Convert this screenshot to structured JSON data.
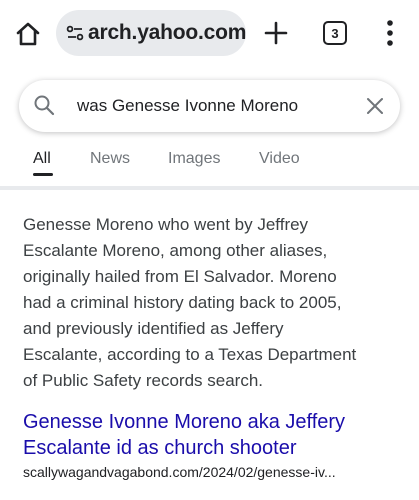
{
  "browser": {
    "url_text": "arch.yahoo.com",
    "tab_count": "3",
    "icons": {
      "home": "home-icon",
      "site_info": "tune-icon",
      "new_tab": "plus-icon",
      "menu": "more-vert-icon"
    }
  },
  "search": {
    "query": "was Genesse Ivonne Moreno",
    "icons": {
      "search": "search-icon",
      "clear": "close-icon"
    }
  },
  "tabs": [
    {
      "label": "All",
      "active": true
    },
    {
      "label": "News",
      "active": false
    },
    {
      "label": "Images",
      "active": false
    },
    {
      "label": "Video",
      "active": false
    }
  ],
  "result": {
    "snippet_lines": [
      "Genesse Moreno who went by Jeffrey",
      "Escalante Moreno, among other aliases,",
      "originally hailed from El Salvador. Moreno",
      "had a criminal history dating back to 2005,",
      "and previously identified as Jeffery",
      "Escalante, according to a Texas Department",
      "of Public Safety records search."
    ],
    "title_lines": [
      "Genesse Ivonne Moreno aka Jeffery",
      "Escalante id as church shooter"
    ],
    "display_url": "scallywagandvagabond.com/2024/02/genesse-iv..."
  },
  "colors": {
    "link": "#1a0dab",
    "text": "#202124",
    "muted": "#70757a",
    "pill_bg": "#e8eaed"
  }
}
